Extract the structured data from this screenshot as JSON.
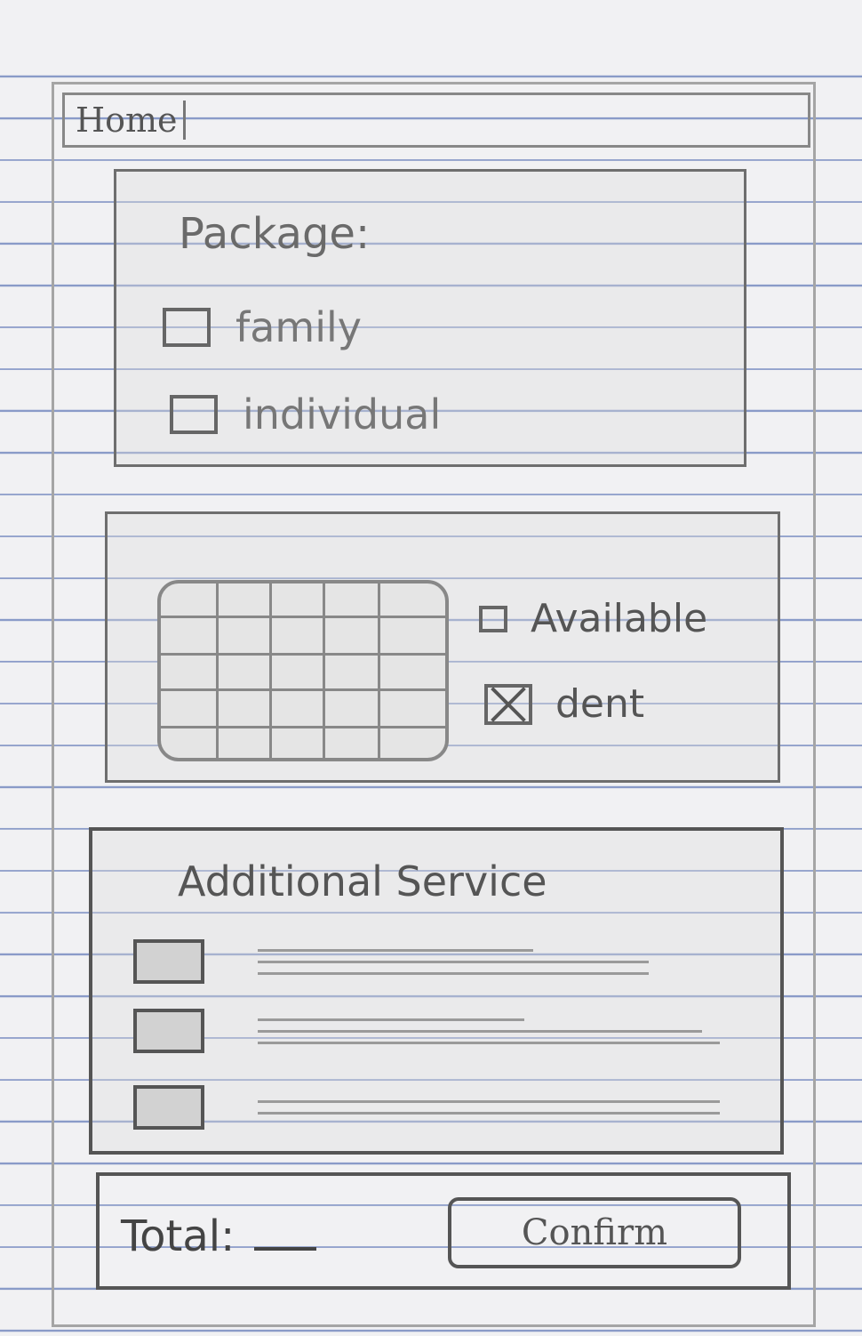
{
  "header": {
    "home_tab": "Home"
  },
  "package": {
    "title": "Package:",
    "options": [
      {
        "label": "family",
        "checked": false
      },
      {
        "label": "individual",
        "checked": false
      }
    ]
  },
  "calendar": {
    "legend": [
      {
        "label": "Available",
        "checked": false
      },
      {
        "label": "dent",
        "checked": true
      }
    ]
  },
  "additional_service": {
    "title": "Additional Service",
    "items": [
      {
        "checked": false
      },
      {
        "checked": false
      },
      {
        "checked": false
      }
    ]
  },
  "footer": {
    "total_label": "Total:",
    "total_value": "",
    "confirm_label": "Confirm"
  }
}
